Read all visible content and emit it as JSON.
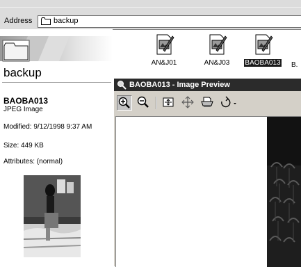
{
  "address": {
    "label": "Address",
    "value": "backup"
  },
  "folder": {
    "title": "backup"
  },
  "files": [
    {
      "label": "AN&J01",
      "selected": false
    },
    {
      "label": "AN&J03",
      "selected": false
    },
    {
      "label": "BAOBA013",
      "selected": true
    },
    {
      "label": "B.",
      "selected": false
    }
  ],
  "details": {
    "name": "BAOBA013",
    "type": "JPEG Image",
    "modified": "Modified: 9/12/1998 9:37 AM",
    "size": "Size: 449 KB",
    "attributes": "Attributes: (normal)"
  },
  "preview": {
    "title": "BAOBA013 - Image Preview",
    "toolbar": [
      "zoom-in-icon",
      "zoom-out-icon",
      "best-fit-icon",
      "actual-size-icon",
      "print-icon",
      "rotate-icon"
    ]
  }
}
